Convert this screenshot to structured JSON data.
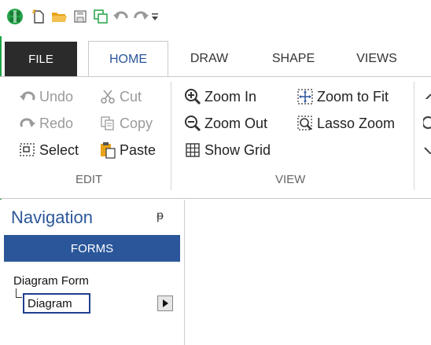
{
  "ribbon_tabs": {
    "file": "FILE",
    "home": "HOME",
    "draw": "DRAW",
    "shape": "SHAPE",
    "views": "VIEWS"
  },
  "edit_group": {
    "undo": "Undo",
    "redo": "Redo",
    "select": "Select",
    "cut": "Cut",
    "copy": "Copy",
    "paste": "Paste",
    "label": "EDIT"
  },
  "view_group": {
    "zoom_in": "Zoom In",
    "zoom_out": "Zoom Out",
    "show_grid": "Show Grid",
    "zoom_to_fit": "Zoom to Fit",
    "lasso_zoom": "Lasso Zoom",
    "label": "VIEW"
  },
  "navigation": {
    "title": "Navigation",
    "pin_glyph": "ᵽ",
    "forms_bar": "FORMS",
    "tree_root": "Diagram Form",
    "tree_child": "Diagram"
  },
  "colors": {
    "accent": "#2b579a",
    "file_tab": "#2b2b2b",
    "app_green": "#22a347",
    "folder_yellow": "#e8a317"
  },
  "icons": [
    "app-logo-icon",
    "new-document-icon",
    "open-folder-icon",
    "save-icon",
    "copy-window-icon",
    "undo-icon",
    "redo-icon",
    "customize-dropdown-icon",
    "cut-icon",
    "copy-icon",
    "paste-icon",
    "select-icon",
    "zoom-in-icon",
    "zoom-out-icon",
    "grid-icon",
    "zoom-to-fit-icon",
    "lasso-zoom-icon",
    "pin-icon",
    "expand-arrow-icon"
  ]
}
